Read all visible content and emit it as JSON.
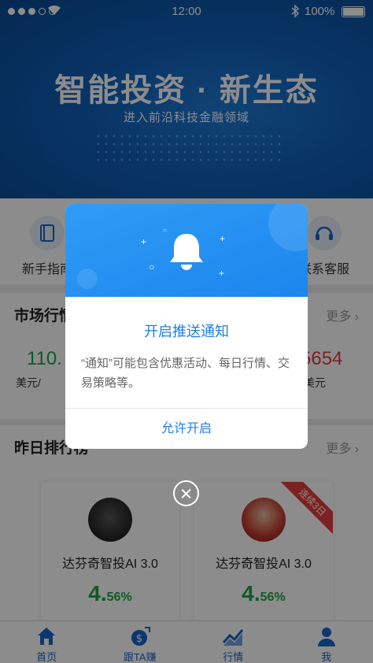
{
  "status_bar": {
    "time": "12:00",
    "battery": "100%"
  },
  "hero": {
    "title": "智能投资 · 新生态",
    "subtitle": "进入前沿科技金融领域"
  },
  "quick_nav": {
    "items": [
      {
        "label": "新手指南",
        "icon": "book-icon"
      },
      {
        "label": "联系客服",
        "icon": "headset-icon"
      }
    ]
  },
  "market": {
    "title": "市场行情",
    "more": "更多",
    "left_value": "110.",
    "left_unit": "美元/",
    "right_value": "5654",
    "right_unit": "/美元"
  },
  "ranking": {
    "title": "昨日排行榜",
    "more": "更多",
    "cards": [
      {
        "name": "达芬奇智投AI 3.0",
        "return_int": "4.",
        "return_dec": "56%",
        "ribbon": ""
      },
      {
        "name": "达芬奇智投AI 3.0",
        "return_int": "4.",
        "return_dec": "56%",
        "ribbon": "连续3日"
      }
    ]
  },
  "tabs": [
    {
      "label": "首页",
      "icon": "home-icon"
    },
    {
      "label": "跟TA赚",
      "icon": "money-bag-icon"
    },
    {
      "label": "行情",
      "icon": "trend-chart-icon"
    },
    {
      "label": "我",
      "icon": "user-icon"
    }
  ],
  "modal": {
    "title": "开启推送通知",
    "body": "“通知”可能包含优惠活动、每日行情、交易策略等。",
    "button": "允许开启"
  },
  "colors": {
    "brand_blue": "#1c7fe6",
    "gain_green": "#1ea34a",
    "loss_red": "#e23b3b"
  }
}
